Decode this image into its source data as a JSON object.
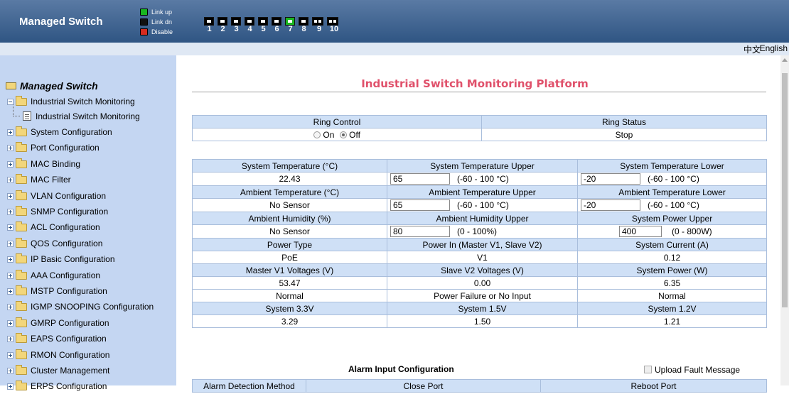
{
  "header": {
    "brand": "Managed Switch",
    "legend": [
      {
        "label": "Link up",
        "color": "#19b51f"
      },
      {
        "label": "Link dn",
        "color": "#111111"
      },
      {
        "label": "Disable",
        "color": "#d62b1f"
      }
    ],
    "ports": [
      {
        "num": "1",
        "status": "dn",
        "dual": false
      },
      {
        "num": "2",
        "status": "dn",
        "dual": false
      },
      {
        "num": "3",
        "status": "dn",
        "dual": false
      },
      {
        "num": "4",
        "status": "dn",
        "dual": false
      },
      {
        "num": "5",
        "status": "dn",
        "dual": false
      },
      {
        "num": "6",
        "status": "dn",
        "dual": false
      },
      {
        "num": "7",
        "status": "up",
        "dual": false
      },
      {
        "num": "8",
        "status": "dn",
        "dual": false
      },
      {
        "num": "9",
        "status": "dn",
        "dual": true
      },
      {
        "num": "10",
        "status": "dn",
        "dual": true
      }
    ]
  },
  "lang": {
    "zh": "中文",
    "en": "English"
  },
  "sidebar": {
    "root": "Managed Switch",
    "open_item": "Industrial Switch Monitoring",
    "leaf": "Industrial Switch Monitoring",
    "items": [
      "System Configuration",
      "Port Configuration",
      "MAC Binding",
      "MAC Filter",
      "VLAN Configuration",
      "SNMP Configuration",
      "ACL Configuration",
      "QOS Configuration",
      "IP Basic Configuration",
      "AAA Configuration",
      "MSTP Configuration",
      "IGMP SNOOPING Configuration",
      "GMRP Configuration",
      "EAPS Configuration",
      "RMON Configuration",
      "Cluster Management",
      "ERPS Configuration"
    ]
  },
  "main": {
    "title": "Industrial Switch Monitoring Platform",
    "ring": {
      "control_label": "Ring Control",
      "status_label": "Ring Status",
      "on": "On",
      "off": "Off",
      "selected": "off",
      "status": "Stop"
    },
    "sys_temp": {
      "label": "System Temperature (°C)",
      "value": "22.43"
    },
    "sys_temp_upper": {
      "label": "System Temperature Upper",
      "value": "65",
      "range": "(-60 - 100 °C)"
    },
    "sys_temp_lower": {
      "label": "System Temperature Lower",
      "value": "-20",
      "range": "(-60 - 100 °C)"
    },
    "amb_temp": {
      "label": "Ambient Temperature (°C)",
      "value": "No Sensor"
    },
    "amb_temp_upper": {
      "label": "Ambient Temperature Upper",
      "value": "65",
      "range": "(-60 - 100 °C)"
    },
    "amb_temp_lower": {
      "label": "Ambient Temperature Lower",
      "value": "-20",
      "range": "(-60 - 100 °C)"
    },
    "amb_hum": {
      "label": "Ambient Humidity (%)",
      "value": "No Sensor"
    },
    "amb_hum_upper": {
      "label": "Ambient Humidity Upper",
      "value": "80",
      "range": "(0 - 100%)"
    },
    "sys_power_upper": {
      "label": "System Power Upper",
      "value": "400",
      "range": "(0 - 800W)"
    },
    "power_type": {
      "label": "Power Type",
      "value": "PoE"
    },
    "power_in": {
      "label": "Power In (Master V1, Slave V2)",
      "value": "V1"
    },
    "sys_current": {
      "label": "System Current (A)",
      "value": "0.12"
    },
    "master_v1": {
      "label": "Master V1 Voltages (V)",
      "value": "53.47",
      "state": "Normal"
    },
    "slave_v2": {
      "label": "Slave V2 Voltages (V)",
      "value": "0.00",
      "state": "Power Failure or No Input"
    },
    "sys_power": {
      "label": "System Power (W)",
      "value": "6.35",
      "state": "Normal"
    },
    "v33": {
      "label": "System 3.3V",
      "value": "3.29"
    },
    "v15": {
      "label": "System 1.5V",
      "value": "1.50"
    },
    "v12": {
      "label": "System 1.2V",
      "value": "1.21"
    },
    "alarm_title": "Alarm Input Configuration",
    "upload_label": "Upload Fault Message",
    "alarm_headers": [
      "Alarm Detection Method",
      "Close Port",
      "Reboot Port"
    ]
  }
}
